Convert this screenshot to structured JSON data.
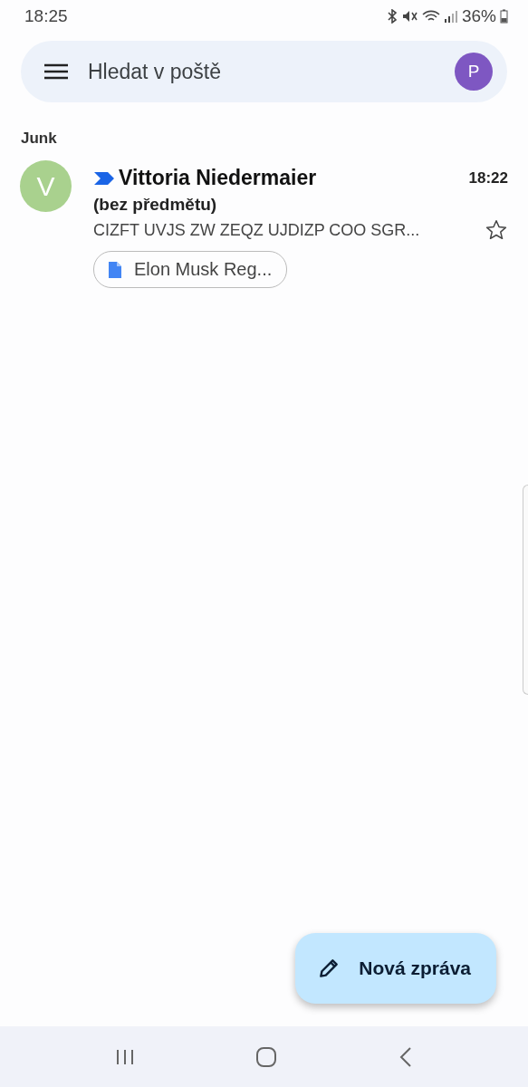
{
  "status_bar": {
    "time": "18:25",
    "battery": "36%"
  },
  "search": {
    "placeholder": "Hledat v poště",
    "avatar": "P"
  },
  "folder": "Junk",
  "emails": [
    {
      "avatar": "V",
      "color": "#a9d18e",
      "important": true,
      "sender": "Vittoria Niedermaier",
      "time": "18:22",
      "subject": "(bez předmětu)",
      "snippet": "CIZFT UVJS ZW ZEQZ UJDIZP COO SGR...",
      "unread": true,
      "starred": false,
      "attachment": "Elon Musk Reg..."
    }
  ],
  "compose": {
    "label": "Nová zpráva"
  }
}
